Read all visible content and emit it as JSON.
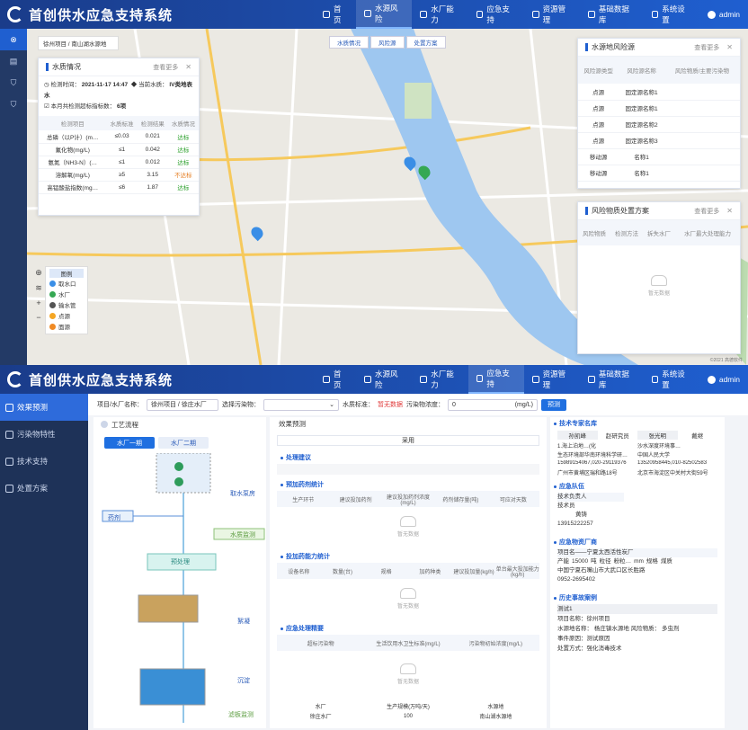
{
  "app": {
    "title": "首创供水应急支持系统",
    "user": "admin"
  },
  "top_nav": [
    {
      "label": "首页",
      "active": false
    },
    {
      "label": "水源风险",
      "active": true
    },
    {
      "label": "水厂能力",
      "active": false
    },
    {
      "label": "应急支持",
      "active": false
    },
    {
      "label": "资源管理",
      "active": false
    },
    {
      "label": "基础数据库",
      "active": false
    },
    {
      "label": "系统设置",
      "active": false
    }
  ],
  "bottom_nav": [
    {
      "label": "首页",
      "active": false
    },
    {
      "label": "水源风险",
      "active": false
    },
    {
      "label": "水厂能力",
      "active": false
    },
    {
      "label": "应急支持",
      "active": true
    },
    {
      "label": "资源管理",
      "active": false
    },
    {
      "label": "基础数据库",
      "active": false
    },
    {
      "label": "系统设置",
      "active": false
    }
  ],
  "map_view": {
    "breadcrumb": "徐州项目 / 南山湖水源地",
    "tabs": [
      "水质情况",
      "风险源",
      "处置方案"
    ],
    "water_quality": {
      "title": "水质情况",
      "more": "查看更多",
      "check_time_label": "检测时间：",
      "check_time": "2021-11-17 14:47",
      "water_level_label": "当前水质：",
      "water_level": "IV类地表水",
      "exceed_label": "本月共检测超标指标数：",
      "exceed_count": "6项",
      "columns": [
        "检测项目",
        "水质标准",
        "检测结果",
        "水质情况"
      ],
      "rows": [
        [
          "总磷（以P计）(m…",
          "≤0.03",
          "0.021",
          "达标"
        ],
        [
          "氟化物(mg/L)",
          "≤1",
          "0.042",
          "达标"
        ],
        [
          "氨氮（NH3-N）(…",
          "≤1",
          "0.012",
          "达标"
        ],
        [
          "溶解氧(mg/L)",
          "≥5",
          "3.15",
          "不达标"
        ],
        [
          "高锰酸盐指数(mg…",
          "≤6",
          "1.87",
          "达标"
        ]
      ]
    },
    "risk_sources": {
      "title": "水源地风险源",
      "more": "查看更多",
      "columns": [
        "风险源类型",
        "风险源名称",
        "风险物质/主要污染物"
      ],
      "rows": [
        [
          "点源",
          "固定源名称1"
        ],
        [
          "点源",
          "固定源名称1"
        ],
        [
          "点源",
          "固定源名称2"
        ],
        [
          "点源",
          "固定源名称3"
        ],
        [
          "移动源",
          "名称1"
        ],
        [
          "移动源",
          "名称1"
        ]
      ]
    },
    "risk_plan": {
      "title": "风险物质处置方案",
      "more": "查看更多",
      "columns": [
        "风险物质",
        "检测方法",
        "拆失水厂",
        "水厂最大处理能力"
      ],
      "empty": "暂无数据"
    },
    "legend": {
      "title": "图例",
      "items": [
        {
          "label": "取水口",
          "color": "#3a8ee6"
        },
        {
          "label": "水厂",
          "color": "#35a853"
        },
        {
          "label": "输水管",
          "color": "#555555"
        },
        {
          "label": "点源",
          "color": "#f5a623"
        },
        {
          "label": "面源",
          "color": "#f08a24"
        }
      ]
    },
    "attribution": "©2021 高德软件"
  },
  "emergency": {
    "side_menu": [
      "效果预测",
      "污染物特性",
      "技术支持",
      "处置方案"
    ],
    "filter": {
      "plant_label": "项目/水厂名称：",
      "plant_value": "徐州项目 / 徐庄水厂",
      "pollutant_label": "选择污染物：",
      "pollutant_value": "",
      "source_label": "水质标准：",
      "source_value": "暂无数据",
      "conc_label": "污染物浓度：",
      "conc_value": "0",
      "conc_unit": "(mg/L)",
      "predict_button": "预测"
    },
    "process": {
      "title": "工艺流程",
      "tabs": [
        "水厂一期",
        "水厂二期"
      ],
      "labels": [
        "取水泵房",
        "药剂",
        "水质监测",
        "预处理",
        "絮凝",
        "沉淀",
        "滤板监测"
      ]
    },
    "prediction": {
      "title": "效果预测",
      "adopt_label": "采用",
      "sections": [
        {
          "title": "处理建议",
          "columns": [],
          "empty": ""
        },
        {
          "title": "预加药剂统计",
          "columns": [
            "生产环节",
            "建议投加药剂",
            "建议投加药剂浓度(mg/L)",
            "药剂储存量(吨)",
            "可应对天数"
          ],
          "empty": "暂无数据"
        },
        {
          "title": "投加药能力统计",
          "columns": [
            "设备名称",
            "数量(台)",
            "规格",
            "加药种类",
            "建议投加量(kg/h)",
            "单台最大投加能力(kg/h)"
          ],
          "empty": "暂无数据"
        },
        {
          "title": "应急处理精要",
          "columns": [
            "超标污染物",
            "生活饮用水卫生标准(mg/L)",
            "污染物初始浓度(mg/L)"
          ],
          "empty": "暂无数据"
        }
      ],
      "bottom_row": [
        [
          "水厂",
          "生产规模(万吨/天)",
          "水源地"
        ],
        [
          "徐庄水厂",
          "100",
          "南山湖水源地"
        ]
      ]
    },
    "info": {
      "expert_title": "技术专家名库",
      "expert_columns": [
        "孙凯峰",
        "赵研究员",
        "张光明",
        "戴继"
      ],
      "expert_rows": [
        [
          "1.海上泊地…(化",
          "沙水深度环境事…"
        ],
        [
          "生态环境部华南环境科学研…",
          "中国人民大学"
        ],
        [
          "15989154067,020-29119376",
          "13520958445,010-82502583"
        ],
        [
          "广州市黄埔区瑞和路18号",
          "北京市海淀区中关村大街59号"
        ]
      ],
      "team_title": "应急队伍",
      "team": {
        "label": "技术负责人",
        "name": "技术员",
        "person": "黄铸",
        "phone": "13915222257"
      },
      "vendor_title": "应急物资厂商",
      "vendor": {
        "name": "项目名——宁夏太西活性炭厂",
        "capacity_label": "产能",
        "capacity": "15000",
        "unit": "吨",
        "type_label": "粒径",
        "type": "粉粒…",
        "size": "mm",
        "spec_label": "规格",
        "spec": "煤质",
        "address": "中国宁夏石嘴山市大武口区长胜路",
        "phone": "0952-2695402"
      },
      "history_title": "历史事故案例",
      "history": {
        "case": "测试1",
        "project_label": "项目名称：",
        "project": "徐州项目",
        "source_label": "水源地名称：",
        "source": "杨庄镇水源地",
        "risk_label": "风险物质：",
        "risk": "多虫剂",
        "time_label": "事件原因：",
        "time": "测试原因",
        "method_label": "处置方式：",
        "method": "强化消毒技术"
      }
    }
  }
}
